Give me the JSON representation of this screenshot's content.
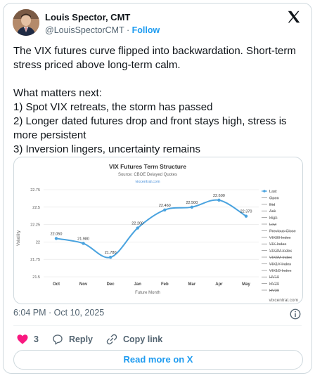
{
  "author": {
    "name": "Louis Spector, CMT",
    "handle": "@LouisSpectorCMT",
    "follow_label": "Follow",
    "separator": "·"
  },
  "tweet": {
    "text": "The VIX futures curve flipped into backwardation. Short-term stress priced above long-term calm.\n\nWhat matters next:\n1) Spot VIX retreats, the storm has passed\n2) Longer dated futures drop and front stays high, stress is more persistent\n3) Inversion lingers, uncertainty remains"
  },
  "meta": {
    "timestamp": "6:04 PM · Oct 10, 2025",
    "likes": "3",
    "reply_label": "Reply",
    "copy_link_label": "Copy link",
    "read_more_label": "Read more on X"
  },
  "colors": {
    "accent": "#1d9bf0",
    "like": "#f91880",
    "series": "#4aa3df"
  },
  "icons": {
    "logo": "x-logo-icon",
    "info": "info-icon",
    "like": "heart-icon",
    "reply": "speech-bubble-icon",
    "copy": "link-icon"
  },
  "chart_data": {
    "type": "line",
    "title": "VIX Futures Term Structure",
    "subtitle": "Source: CBOE Delayed Quotes",
    "site": "vixcentral.com",
    "watermark": "vixcentral.com",
    "xlabel": "Future Month",
    "ylabel": "Volatility",
    "categories": [
      "Oct",
      "Nov",
      "Dec",
      "Jan",
      "Feb",
      "Mar",
      "Apr",
      "May"
    ],
    "series": [
      {
        "name": "Last",
        "values": [
          22.05,
          21.98,
          21.78,
          22.2,
          22.46,
          22.5,
          22.6,
          22.37
        ]
      }
    ],
    "data_labels": [
      "22.050",
      "21.980",
      "21.780",
      "22.200",
      "22.460",
      "22.500",
      "22.600",
      "22.370"
    ],
    "yticks": [
      "21.5",
      "21.75",
      "22",
      "22.25",
      "22.5",
      "22.75"
    ],
    "ylim": [
      21.5,
      22.75
    ],
    "grid": true,
    "legend_position": "right",
    "legend": [
      "Last",
      "Open",
      "Bid",
      "Ask",
      "High",
      "Low",
      "Previous Close",
      "VIX30 Index",
      "VIX Index",
      "VIX3M Index",
      "VIX6M Index",
      "VIX1Y Index",
      "VIX1D Index",
      "HV10",
      "HV20",
      "HV30"
    ],
    "legend_hidden": [
      false,
      true,
      true,
      true,
      true,
      true,
      true,
      true,
      true,
      true,
      true,
      true,
      true,
      true,
      true,
      true
    ]
  }
}
